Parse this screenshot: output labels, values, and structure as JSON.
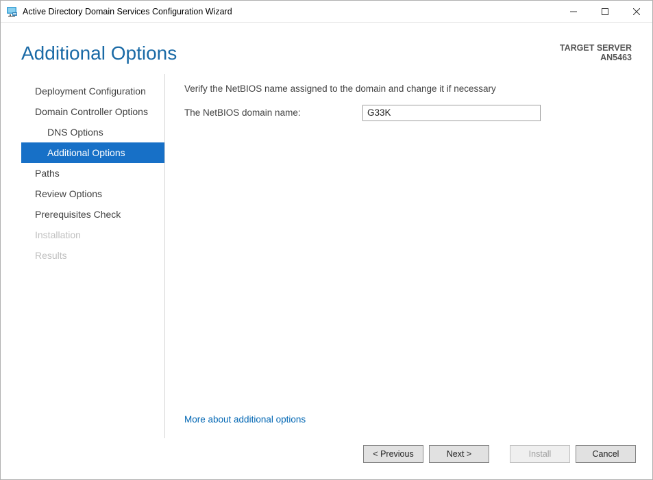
{
  "titlebar": {
    "title": "Active Directory Domain Services Configuration Wizard"
  },
  "header": {
    "heading": "Additional Options",
    "target_label": "TARGET SERVER",
    "target_server": "AN5463"
  },
  "sidebar": {
    "steps": [
      {
        "label": "Deployment Configuration",
        "indent": false,
        "selected": false,
        "disabled": false
      },
      {
        "label": "Domain Controller Options",
        "indent": false,
        "selected": false,
        "disabled": false
      },
      {
        "label": "DNS Options",
        "indent": true,
        "selected": false,
        "disabled": false
      },
      {
        "label": "Additional Options",
        "indent": true,
        "selected": true,
        "disabled": false
      },
      {
        "label": "Paths",
        "indent": false,
        "selected": false,
        "disabled": false
      },
      {
        "label": "Review Options",
        "indent": false,
        "selected": false,
        "disabled": false
      },
      {
        "label": "Prerequisites Check",
        "indent": false,
        "selected": false,
        "disabled": false
      },
      {
        "label": "Installation",
        "indent": false,
        "selected": false,
        "disabled": true
      },
      {
        "label": "Results",
        "indent": false,
        "selected": false,
        "disabled": true
      }
    ]
  },
  "content": {
    "instruction": "Verify the NetBIOS name assigned to the domain and change it if necessary",
    "field_label": "The NetBIOS domain name:",
    "netbios_value": "G33K",
    "more_link": "More about additional options"
  },
  "footer": {
    "previous": "< Previous",
    "next": "Next >",
    "install": "Install",
    "cancel": "Cancel"
  }
}
